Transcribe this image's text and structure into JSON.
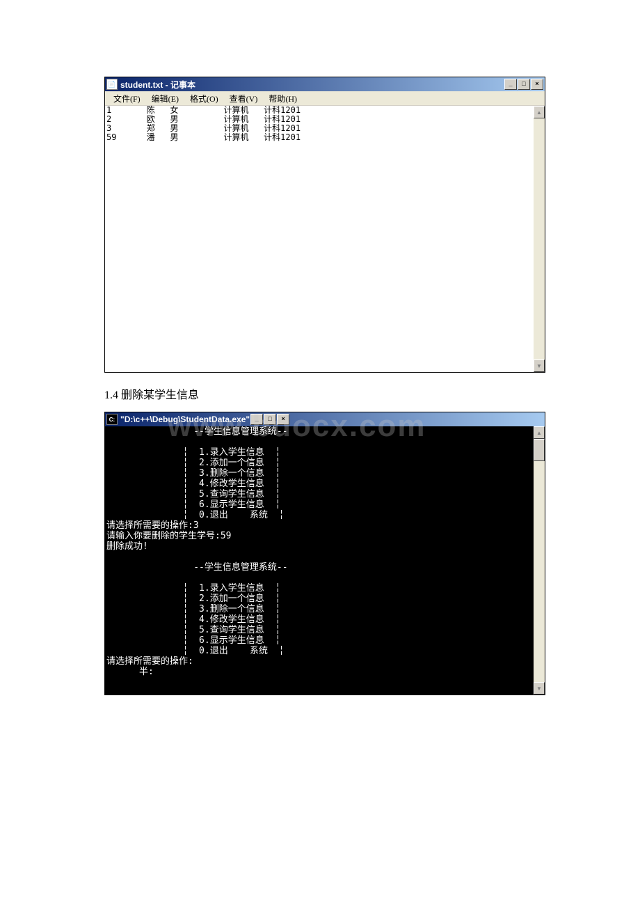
{
  "notepad": {
    "title": "student.txt - 记事本",
    "menus": {
      "file": "文件(F)",
      "edit": "编辑(E)",
      "format": "格式(O)",
      "view": "查看(V)",
      "help": "帮助(H)"
    },
    "content": "1       陈   女         计算机   计科1201\n2       欧   男         计算机   计科1201\n3       郑   男         计算机   计科1201\n59      潘   男         计算机   计科1201"
  },
  "caption": "1.4 删除某学生信息",
  "watermark": "www.bdocx.com",
  "console": {
    "title": "\"D:\\c++\\Debug\\StudentData.exe\"",
    "content": "                --学生信息管理系统--\n\n              ╎  1.录入学生信息  ╎\n              ╎  2.添加一个信息  ╎\n              ╎  3.删除一个信息  ╎\n              ╎  4.修改学生信息  ╎\n              ╎  5.查询学生信息  ╎\n              ╎  6.显示学生信息  ╎\n              ╎  0.退出    系统  ╎\n请选择所需要的操作:3\n请输入你要删除的学生学号:59\n删除成功!\n\n                --学生信息管理系统--\n\n              ╎  1.录入学生信息  ╎\n              ╎  2.添加一个信息  ╎\n              ╎  3.删除一个信息  ╎\n              ╎  4.修改学生信息  ╎\n              ╎  5.查询学生信息  ╎\n              ╎  6.显示学生信息  ╎\n              ╎  0.退出    系统  ╎\n请选择所需要的操作:\n      半:"
  },
  "winbtns": {
    "min": "_",
    "max": "□",
    "close": "×"
  },
  "arrows": {
    "up": "▲",
    "down": "▼"
  }
}
